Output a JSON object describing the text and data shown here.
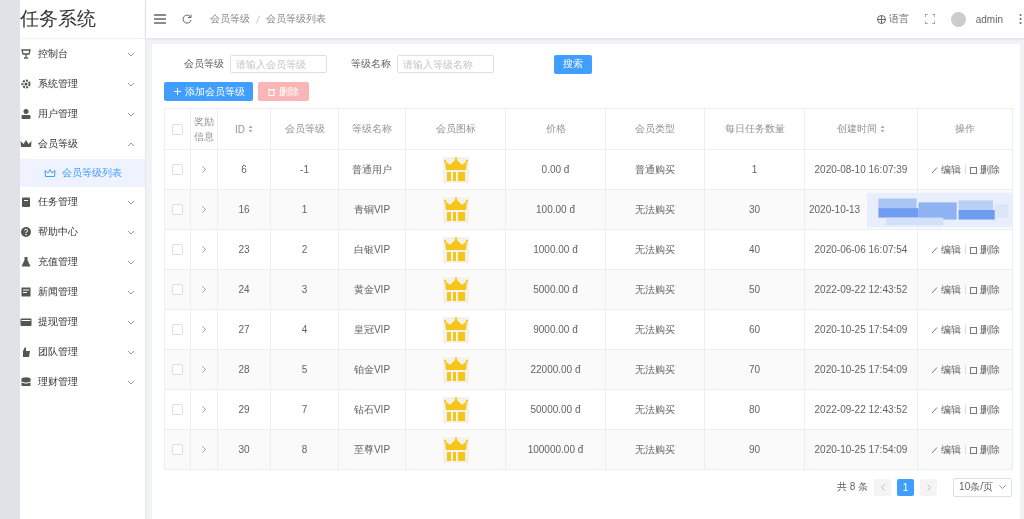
{
  "app": {
    "title": "任务系统"
  },
  "sidebar": {
    "items": [
      {
        "label": "控制台",
        "expanded": false
      },
      {
        "label": "系统管理",
        "expanded": false
      },
      {
        "label": "用户管理",
        "expanded": false
      },
      {
        "label": "会员等级",
        "expanded": true,
        "children": [
          {
            "label": "会员等级列表",
            "selected": true
          }
        ]
      },
      {
        "label": "任务管理",
        "expanded": false
      },
      {
        "label": "帮助中心",
        "expanded": false
      },
      {
        "label": "充值管理",
        "expanded": false
      },
      {
        "label": "新闻管理",
        "expanded": false
      },
      {
        "label": "提现管理",
        "expanded": false
      },
      {
        "label": "团队管理",
        "expanded": false
      },
      {
        "label": "理财管理",
        "expanded": false
      }
    ]
  },
  "header": {
    "breadcrumbs": [
      "会员等级",
      "会员等级列表"
    ],
    "language": "语言",
    "user": "admin"
  },
  "filters": [
    {
      "label": "会员等级",
      "placeholder": "请输入会员等级"
    },
    {
      "label": "等级名称",
      "placeholder": "请输入等级名称"
    }
  ],
  "search_button": "搜索",
  "toolbar": [
    {
      "label": "添加会员等级",
      "kind": "primary",
      "disabled": false
    },
    {
      "label": "删除",
      "kind": "danger",
      "disabled": true
    }
  ],
  "table": {
    "select_all_checked": false,
    "columns": [
      {
        "kind": "checkbox"
      },
      {
        "kind": "text",
        "label": "奖励信息"
      },
      {
        "kind": "text",
        "label": "ID",
        "sortable": true
      },
      {
        "kind": "text",
        "label": "会员等级"
      },
      {
        "kind": "text",
        "label": "等级名称"
      },
      {
        "kind": "text",
        "label": "会员图标"
      },
      {
        "kind": "text",
        "label": "价格"
      },
      {
        "kind": "text",
        "label": "会员类型"
      },
      {
        "kind": "text",
        "label": "每日任务数量"
      },
      {
        "kind": "text",
        "label": "创建时间",
        "sortable": true
      },
      {
        "kind": "text",
        "label": "操作"
      }
    ],
    "rows": [
      {
        "checked": false,
        "id": "6",
        "level": "-1",
        "name": "普通用户",
        "price": "0.00 đ",
        "type": "普通购买",
        "daily": "1",
        "created": "2020-08-10 16:07:39",
        "actions": [
          "编辑",
          "删除"
        ],
        "redacted": false
      },
      {
        "checked": false,
        "id": "16",
        "level": "1",
        "name": "青铜VIP",
        "price": "100.00 đ",
        "type": "无法购买",
        "daily": "30",
        "created": "2020-10-13",
        "actions": [],
        "redacted": true
      },
      {
        "checked": false,
        "id": "23",
        "level": "2",
        "name": "白银VIP",
        "price": "1000.00 đ",
        "type": "无法购买",
        "daily": "40",
        "created": "2020-06-06 16:07:54",
        "actions": [
          "编辑",
          "删除"
        ],
        "redacted": false
      },
      {
        "checked": false,
        "id": "24",
        "level": "3",
        "name": "黄金VIP",
        "price": "5000.00 đ",
        "type": "无法购买",
        "daily": "50",
        "created": "2022-09-22 12:43:52",
        "actions": [
          "编辑",
          "删除"
        ],
        "redacted": false
      },
      {
        "checked": false,
        "id": "27",
        "level": "4",
        "name": "皇冠VIP",
        "price": "9000.00 đ",
        "type": "无法购买",
        "daily": "60",
        "created": "2020-10-25 17:54:09",
        "actions": [
          "编辑",
          "删除"
        ],
        "redacted": false
      },
      {
        "checked": false,
        "id": "28",
        "level": "5",
        "name": "铂金VIP",
        "price": "22000.00 đ",
        "type": "无法购买",
        "daily": "70",
        "created": "2020-10-25 17:54:09",
        "actions": [
          "编辑",
          "删除"
        ],
        "redacted": false
      },
      {
        "checked": false,
        "id": "29",
        "level": "7",
        "name": "钻石VIP",
        "price": "50000.00 đ",
        "type": "无法购买",
        "daily": "80",
        "created": "2022-09-22 12:43:52",
        "actions": [
          "编辑",
          "删除"
        ],
        "redacted": false
      },
      {
        "checked": false,
        "id": "30",
        "level": "8",
        "name": "至尊VIP",
        "price": "100000.00 đ",
        "type": "无法购买",
        "daily": "90",
        "created": "2020-10-25 17:54:09",
        "actions": [
          "编辑",
          "删除"
        ],
        "redacted": false
      }
    ]
  },
  "pagination": {
    "total": "共 8 条",
    "pages": [
      {
        "label": "1",
        "selected": true
      }
    ],
    "page_size": "10条/页"
  }
}
